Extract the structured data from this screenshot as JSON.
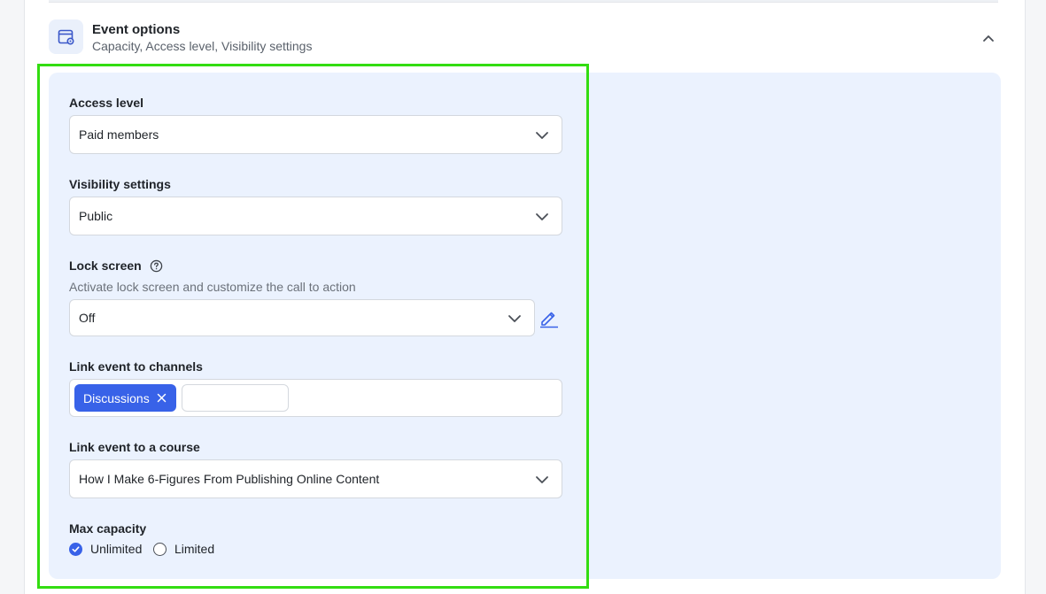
{
  "section": {
    "title": "Event options",
    "subtitle": "Capacity, Access level, Visibility settings"
  },
  "access_level": {
    "label": "Access level",
    "value": "Paid members"
  },
  "visibility": {
    "label": "Visibility settings",
    "value": "Public"
  },
  "lock_screen": {
    "label": "Lock screen",
    "description": "Activate lock screen and customize the call to action",
    "value": "Off"
  },
  "channels": {
    "label": "Link event to channels",
    "tags": [
      "Discussions"
    ],
    "input_value": ""
  },
  "course": {
    "label": "Link event to a course",
    "value": "How I Make 6-Figures From Publishing Online Content"
  },
  "capacity": {
    "label": "Max capacity",
    "options": [
      "Unlimited",
      "Limited"
    ],
    "selected": "Unlimited"
  },
  "colors": {
    "accent": "#3862e8",
    "panel": "#ebf2fe",
    "highlight": "#33dd11"
  }
}
